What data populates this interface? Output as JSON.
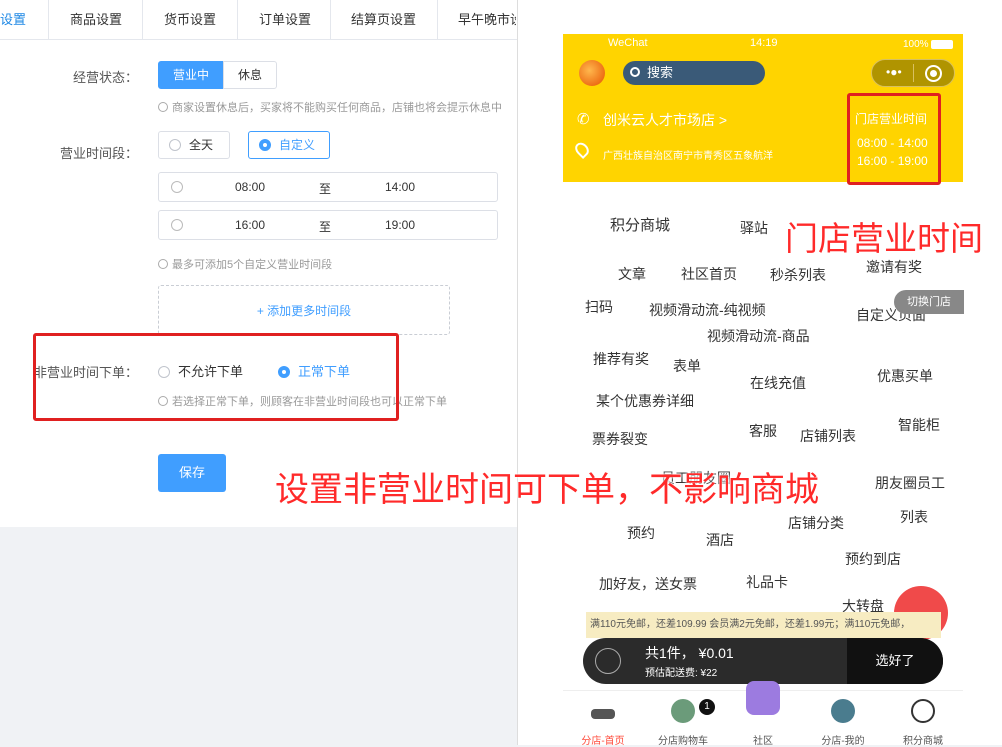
{
  "tabs": [
    {
      "label": "设置",
      "active": true
    },
    {
      "label": "商品设置"
    },
    {
      "label": "货币设置"
    },
    {
      "label": "订单设置"
    },
    {
      "label": "结算页设置"
    },
    {
      "label": "早午晚市设"
    }
  ],
  "form": {
    "status_label": "经营状态：",
    "status_open": "营业中",
    "status_rest": "休息",
    "status_hint": "商家设置休息后，买家将不能购买任何商品，店铺也将会提示休息中",
    "period_label": "营业时间段：",
    "period_all": "全天",
    "period_custom": "自定义",
    "ranges": [
      {
        "start": "08:00",
        "to": "至",
        "end": "14:00"
      },
      {
        "start": "16:00",
        "to": "至",
        "end": "19:00"
      }
    ],
    "range_hint": "最多可添加5个自定义营业时间段",
    "add_more": "+ 添加更多时间段",
    "offhours_label": "非营业时间下单：",
    "offhours_deny": "不允许下单",
    "offhours_allow": "正常下单",
    "offhours_hint": "若选择正常下单，则顾客在非营业时间段也可以正常下单",
    "save": "保存"
  },
  "annotations": {
    "main": "设置非营业时间可下单，不影响商城",
    "phone": "门店营业时间"
  },
  "phone": {
    "status_carrier": "WeChat",
    "status_time": "14:19",
    "status_battery": "100%",
    "search_placeholder": "搜索",
    "store_name": "创米云人才市场店 >",
    "store_address": "广西壮族自治区南宁市青秀区五象航洋",
    "hours_title": "门店营业时间",
    "hours_1": "08:00 - 14:00",
    "hours_2": "16:00 - 19:00",
    "switch_store": "切换门店",
    "links": [
      "积分商城",
      "驿站",
      "文章",
      "社区首页",
      "秒杀列表",
      "邀请有奖",
      "扫码",
      "视频滑动流-纯视频",
      "自定义页面",
      "视频滑动流-商品",
      "推荐有奖",
      "表单",
      "在线充值",
      "优惠买单",
      "某个优惠券详细",
      "客服",
      "店铺列表",
      "智能柜",
      "票券裂变",
      "员工朋友圈",
      "朋友圈员工",
      "列表",
      "预约",
      "酒店",
      "店铺分类",
      "预约到店",
      "加好友，送女票",
      "礼品卡",
      "大转盘"
    ],
    "promo": "满110元免邮，还差109.99  会员满2元免邮，还差1.99元；满110元免邮，",
    "cart_summary": "共1件， ¥0.01",
    "cart_fee": "预估配送费: ¥22",
    "cart_button": "选好了",
    "cart_badge": "1",
    "nav": [
      {
        "label": "分店-首页",
        "active": true
      },
      {
        "label": "分店购物车"
      },
      {
        "label": "社区"
      },
      {
        "label": "分店-我的"
      },
      {
        "label": "积分商城"
      }
    ],
    "brand_yellow": "#ffd400",
    "accent_red": "#e02020"
  }
}
